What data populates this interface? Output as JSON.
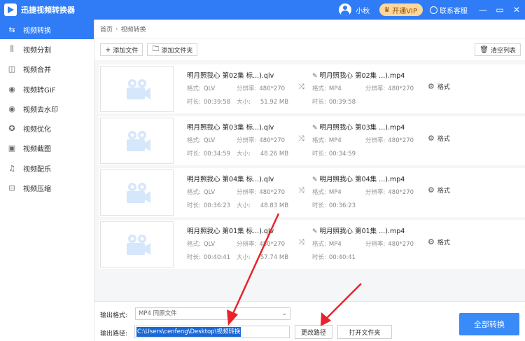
{
  "app": {
    "title": "迅捷视频转换器"
  },
  "header": {
    "user_name": "小秋",
    "vip_label": "开通VIP",
    "support_label": "联系客服",
    "min": "—",
    "restore": "▭",
    "close": "✕"
  },
  "sidebar": {
    "items": [
      {
        "label": "视频转换",
        "icon": "video-convert-icon",
        "glyph": "⇆"
      },
      {
        "label": "视频分割",
        "icon": "split-icon",
        "glyph": "⫼"
      },
      {
        "label": "视频合并",
        "icon": "merge-icon",
        "glyph": "◫"
      },
      {
        "label": "视频转GIF",
        "icon": "gif-icon",
        "glyph": "◉"
      },
      {
        "label": "视频去水印",
        "icon": "watermark-icon",
        "glyph": "◉"
      },
      {
        "label": "视频优化",
        "icon": "optimize-icon",
        "glyph": "✪"
      },
      {
        "label": "视频截图",
        "icon": "screenshot-icon",
        "glyph": "▣"
      },
      {
        "label": "视频配乐",
        "icon": "music-icon",
        "glyph": "♫"
      },
      {
        "label": "视频压缩",
        "icon": "compress-icon",
        "glyph": "⊡"
      }
    ]
  },
  "breadcrumb": {
    "home": "首页",
    "sep": "›",
    "current": "视频转换"
  },
  "toolbar": {
    "add_file": "添加文件",
    "add_folder": "添加文件夹",
    "clear_list": "清空列表"
  },
  "labels": {
    "format": "格式:",
    "resolution": "分辨率:",
    "duration": "时长:",
    "size": "大小:",
    "settings": "格式"
  },
  "files": [
    {
      "src_name": "明月照我心 第02集 标...).qlv",
      "src_format": "QLV",
      "src_resolution": "480*270",
      "src_duration": "00:39:58",
      "src_size": "51.92 MB",
      "dst_name": "明月照我心 第02集 ...).mp4",
      "dst_format": "MP4",
      "dst_resolution": "480*270",
      "dst_duration": "00:39:58"
    },
    {
      "src_name": "明月照我心 第03集 标...).qlv",
      "src_format": "QLV",
      "src_resolution": "480*270",
      "src_duration": "00:34:59",
      "src_size": "48.26 MB",
      "dst_name": "明月照我心 第03集 ...).mp4",
      "dst_format": "MP4",
      "dst_resolution": "480*270",
      "dst_duration": "00:34:59"
    },
    {
      "src_name": "明月照我心 第04集 标...).qlv",
      "src_format": "QLV",
      "src_resolution": "480*270",
      "src_duration": "00:36:23",
      "src_size": "48.83 MB",
      "dst_name": "明月照我心 第04集 ...).mp4",
      "dst_format": "MP4",
      "dst_resolution": "480*270",
      "dst_duration": "00:36:23"
    },
    {
      "src_name": "明月照我心 第01集 标...).qlv",
      "src_format": "QLV",
      "src_resolution": "480*270",
      "src_duration": "00:40:41",
      "src_size": "57.74 MB",
      "dst_name": "明月照我心 第01集 ...).mp4",
      "dst_format": "MP4",
      "dst_resolution": "480*270",
      "dst_duration": "00:40:41"
    }
  ],
  "bottom": {
    "format_label": "输出格式:",
    "format_value": "MP4  同原文件",
    "path_label": "输出路径:",
    "path_value": "C:\\Users\\cenfeng\\Desktop\\视频转换",
    "change_path": "更改路径",
    "open_folder": "打开文件夹",
    "convert_all": "全部转换"
  },
  "colors": {
    "accent": "#2f7cf6",
    "vip": "#ffd79a",
    "annotation_arrow": "#e8232a"
  }
}
